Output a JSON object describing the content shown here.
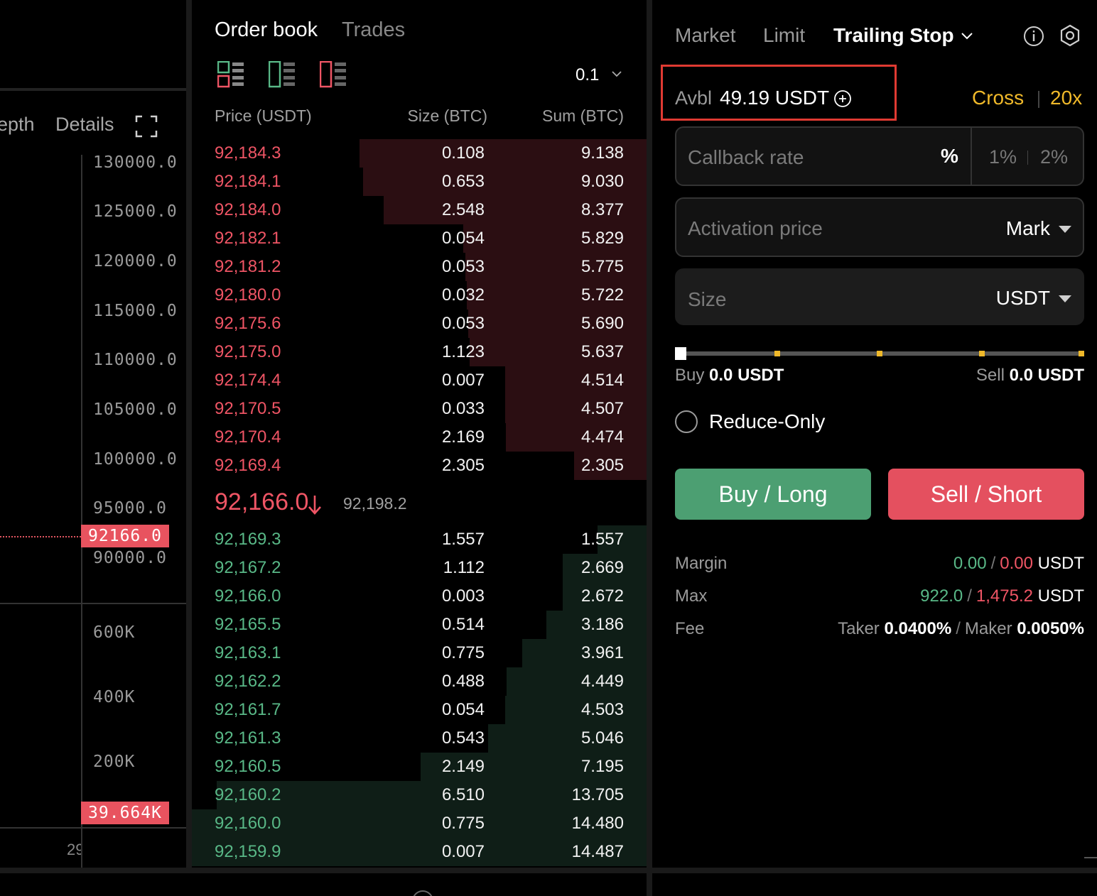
{
  "chart": {
    "tabs": [
      "epth",
      "Details"
    ],
    "price_ticks": [
      "130000.0",
      "125000.0",
      "120000.0",
      "115000.0",
      "110000.0",
      "105000.0",
      "100000.0",
      "95000.0",
      "90000.0"
    ],
    "last_price_tag": "92166.0",
    "volume_ticks": [
      "600K",
      "400K",
      "200K"
    ],
    "volume_tag": "39.664K",
    "time_stub": "29"
  },
  "orderbook": {
    "tabs": {
      "order_book": "Order book",
      "trades": "Trades"
    },
    "precision": "0.1",
    "headers": {
      "price": "Price (USDT)",
      "size": "Size (BTC)",
      "sum": "Sum (BTC)"
    },
    "max_sum": 14.487,
    "asks": [
      {
        "price": "92,184.3",
        "size": "0.108",
        "sum": "9.138"
      },
      {
        "price": "92,184.1",
        "size": "0.653",
        "sum": "9.030"
      },
      {
        "price": "92,184.0",
        "size": "2.548",
        "sum": "8.377"
      },
      {
        "price": "92,182.1",
        "size": "0.054",
        "sum": "5.829"
      },
      {
        "price": "92,181.2",
        "size": "0.053",
        "sum": "5.775"
      },
      {
        "price": "92,180.0",
        "size": "0.032",
        "sum": "5.722"
      },
      {
        "price": "92,175.6",
        "size": "0.053",
        "sum": "5.690"
      },
      {
        "price": "92,175.0",
        "size": "1.123",
        "sum": "5.637"
      },
      {
        "price": "92,174.4",
        "size": "0.007",
        "sum": "4.514"
      },
      {
        "price": "92,170.5",
        "size": "0.033",
        "sum": "4.507"
      },
      {
        "price": "92,170.4",
        "size": "2.169",
        "sum": "4.474"
      },
      {
        "price": "92,169.4",
        "size": "2.305",
        "sum": "2.305"
      }
    ],
    "mid_price": "92,166.0",
    "mark_price": "92,198.2",
    "bids": [
      {
        "price": "92,169.3",
        "size": "1.557",
        "sum": "1.557"
      },
      {
        "price": "92,167.2",
        "size": "1.112",
        "sum": "2.669"
      },
      {
        "price": "92,166.0",
        "size": "0.003",
        "sum": "2.672"
      },
      {
        "price": "92,165.5",
        "size": "0.514",
        "sum": "3.186"
      },
      {
        "price": "92,163.1",
        "size": "0.775",
        "sum": "3.961"
      },
      {
        "price": "92,162.2",
        "size": "0.488",
        "sum": "4.449"
      },
      {
        "price": "92,161.7",
        "size": "0.054",
        "sum": "4.503"
      },
      {
        "price": "92,161.3",
        "size": "0.543",
        "sum": "5.046"
      },
      {
        "price": "92,160.5",
        "size": "2.149",
        "sum": "7.195"
      },
      {
        "price": "92,160.2",
        "size": "6.510",
        "sum": "13.705"
      },
      {
        "price": "92,160.0",
        "size": "0.775",
        "sum": "14.480"
      },
      {
        "price": "92,159.9",
        "size": "0.007",
        "sum": "14.487"
      }
    ]
  },
  "trade": {
    "order_types": {
      "market": "Market",
      "limit": "Limit",
      "trailing": "Trailing Stop"
    },
    "avbl": {
      "label": "Avbl",
      "value": "49.19 USDT"
    },
    "margin_mode": "Cross",
    "leverage": "20x",
    "callback": {
      "placeholder": "Callback rate",
      "unit": "%",
      "preset_1": "1%",
      "preset_2": "2%"
    },
    "activation": {
      "placeholder": "Activation price",
      "type": "Mark"
    },
    "size": {
      "placeholder": "Size",
      "unit": "USDT"
    },
    "slider_fraction": 0,
    "buy_amount": {
      "label": "Buy",
      "value": "0.0 USDT"
    },
    "sell_amount": {
      "label": "Sell",
      "value": "0.0 USDT"
    },
    "reduce_only": "Reduce-Only",
    "buy_button": "Buy / Long",
    "sell_button": "Sell / Short",
    "margin": {
      "label": "Margin",
      "buy": "0.00",
      "sell": "0.00",
      "unit": "USDT"
    },
    "max": {
      "label": "Max",
      "buy": "922.0",
      "sell": "1,475.2",
      "unit": "USDT"
    },
    "fee": {
      "label": "Fee",
      "taker_label": "Taker",
      "taker": "0.0400%",
      "maker_label": "Maker",
      "maker": "0.0050%"
    },
    "colors": {
      "accent": "#f0b92a",
      "buy": "#4c9f72",
      "sell": "#e4505f"
    }
  }
}
